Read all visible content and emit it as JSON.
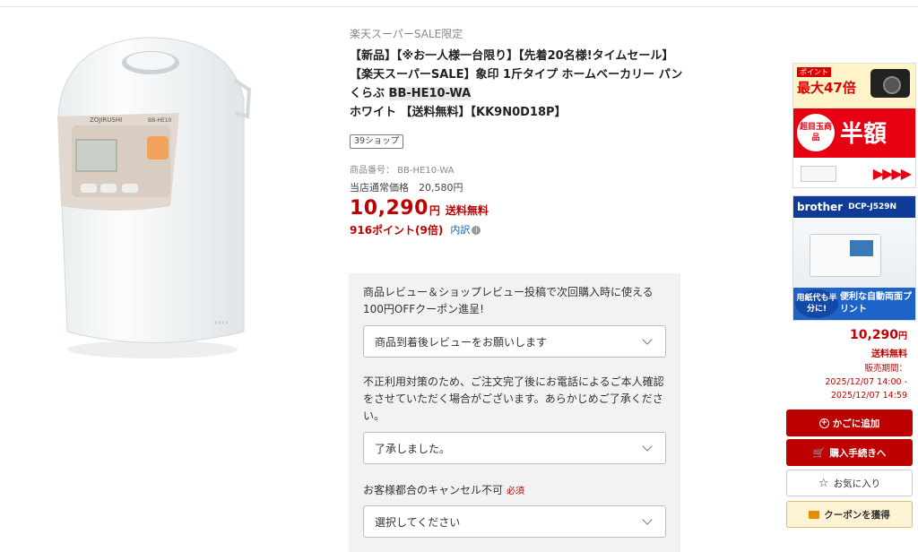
{
  "product": {
    "sale_tag": "楽天スーパーSALE限定",
    "title_before": "【新品】【※お一人様一台限り】【先着20名様!タイムセール】【楽天スーパーSALE】象印 1斤タイプ ホームベーカリー パンくらぶ ",
    "title_model": "BB-HE10-WA",
    "title_after": " ホワイト 【送料無料】【KK9N0D18P】",
    "shop_badge": "39ショップ",
    "item_number": "商品番号： BB-HE10-WA",
    "regular_price": "当店通常価格　20,580円",
    "price": "10,290",
    "yen": "円",
    "shipping": "送料無料",
    "points": "916ポイント(9倍)",
    "breakdown": "内訳",
    "image_brand": "ZOJIRUSHI",
    "image_model": "BB-HE10"
  },
  "options": {
    "review_label": "商品レビュー＆ショップレビュー投稿で次回購入時に使える100円OFFクーポン進呈!",
    "review_value": "商品到着後レビューをお願いします",
    "phone_label": "不正利用対策のため、ご注文完了後にお電話によるご本人確認をさせていただく場合がございます。あらかじめご了承ください。",
    "phone_value": "了承しました。",
    "cancel_label": "お客様都合のキャンセル不可",
    "required": "必須",
    "cancel_placeholder": "選択してください"
  },
  "ads": {
    "ad1_points": "ポイント",
    "ad1_max": "最大47倍",
    "ad1_circle": "超目玉商品",
    "ad1_half": "半額",
    "ad1_arrows": "▶▶▶▶",
    "ad2_brand": "brother",
    "ad2_model": "DCP-J529N",
    "ad2_badge": "用紙代も半分に!",
    "ad2_text": "便利な自動両面プリント"
  },
  "side": {
    "price": "10,290",
    "yen": "円",
    "shipping": "送料無料",
    "period_label": "販売期間：",
    "period_start": "2025/12/07 14:00 -",
    "period_end": "2025/12/07 14:59",
    "add_cart": "かごに追加",
    "buy": "購入手続きへ",
    "favorite": "お気に入り",
    "coupon": "クーポンを獲得"
  },
  "colors": {
    "accent": "#bf0000",
    "link": "#0a5ea8"
  }
}
